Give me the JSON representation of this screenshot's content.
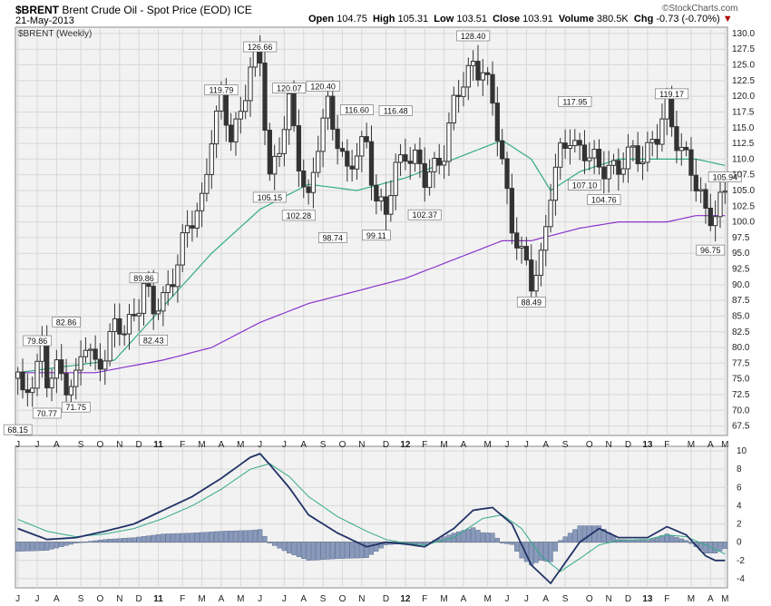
{
  "header": {
    "symbol": "$BRENT",
    "name": "Brent Crude Oil - Spot Price (EOD)",
    "exchange": "ICE",
    "date": "21-May-2013",
    "open_label": "Open",
    "open": "104.75",
    "high_label": "High",
    "high": "105.31",
    "low_label": "Low",
    "low": "103.51",
    "close_label": "Close",
    "close": "103.91",
    "volume_label": "Volume",
    "volume": "380.5K",
    "chg_label": "Chg",
    "chg": "-0.73 (-0.70%)",
    "brand": "©StockCharts.com"
  },
  "colors": {
    "candle": "#333333",
    "ma_short": "#33aa88",
    "ma_long": "#8833cc",
    "macd": "#223366",
    "signal": "#33aa88",
    "histogram": "#8899bb",
    "panel_bg": "#f2f2f2",
    "grid": "#d8d8d8"
  },
  "chart_data": [
    {
      "type": "candlestick",
      "legend": "$BRENT (Weekly)",
      "ylim": [
        66,
        131
      ],
      "y_ticks": [
        67.5,
        70,
        72.5,
        75,
        77.5,
        80,
        82.5,
        85,
        87.5,
        90,
        92.5,
        95,
        97.5,
        100,
        102.5,
        105,
        107.5,
        110,
        112.5,
        115,
        117.5,
        120,
        122.5,
        125,
        127.5,
        130
      ],
      "y_tick_labels": [
        "67.5",
        "70.0",
        "72.5",
        "75.0",
        "77.5",
        "80.0",
        "82.5",
        "85.0",
        "87.5",
        "90.0",
        "92.5",
        "95.0",
        "97.5",
        "100.0",
        "102.5",
        "105.0",
        "107.5",
        "110.0",
        "112.5",
        "115.0",
        "117.5",
        "120.0",
        "122.5",
        "125.0",
        "127.5",
        "130.0"
      ],
      "x_labels": [
        "J",
        "J",
        "A",
        "S",
        "O",
        "N",
        "D",
        "11",
        "F",
        "M",
        "A",
        "M",
        "J",
        "J",
        "A",
        "S",
        "O",
        "N",
        "D",
        "12",
        "F",
        "M",
        "A",
        "M",
        "J",
        "J",
        "A",
        "S",
        "O",
        "N",
        "D",
        "13",
        "F",
        "M",
        "A",
        "M"
      ],
      "close_anchors": [
        [
          0,
          75
        ],
        [
          1,
          71
        ],
        [
          3,
          76
        ],
        [
          5,
          80
        ],
        [
          6,
          74
        ],
        [
          8,
          76
        ],
        [
          10,
          75
        ],
        [
          12,
          75
        ],
        [
          13,
          78
        ],
        [
          14,
          80
        ],
        [
          16,
          77
        ],
        [
          18,
          80
        ],
        [
          20,
          83
        ],
        [
          22,
          82
        ],
        [
          24,
          86
        ],
        [
          26,
          90
        ],
        [
          28,
          85
        ],
        [
          30,
          88
        ],
        [
          32,
          92
        ],
        [
          34,
          96
        ],
        [
          36,
          100
        ],
        [
          38,
          104
        ],
        [
          40,
          114
        ],
        [
          42,
          118
        ],
        [
          44,
          114
        ],
        [
          46,
          118
        ],
        [
          48,
          124
        ],
        [
          50,
          125
        ],
        [
          52,
          108
        ],
        [
          54,
          112
        ],
        [
          56,
          118
        ],
        [
          58,
          110
        ],
        [
          60,
          104
        ],
        [
          62,
          112
        ],
        [
          64,
          118
        ],
        [
          66,
          114
        ],
        [
          68,
          108
        ],
        [
          70,
          110
        ],
        [
          72,
          113
        ],
        [
          74,
          104
        ],
        [
          76,
          101
        ],
        [
          78,
          108
        ],
        [
          80,
          112
        ],
        [
          82,
          110
        ],
        [
          84,
          106
        ],
        [
          86,
          109
        ],
        [
          88,
          112
        ],
        [
          90,
          118
        ],
        [
          92,
          122
        ],
        [
          94,
          126
        ],
        [
          96,
          124
        ],
        [
          98,
          118
        ],
        [
          100,
          110
        ],
        [
          102,
          100
        ],
        [
          104,
          94
        ],
        [
          106,
          90
        ],
        [
          108,
          95
        ],
        [
          110,
          105
        ],
        [
          112,
          110
        ],
        [
          114,
          114
        ],
        [
          116,
          112
        ],
        [
          118,
          110
        ],
        [
          120,
          108
        ],
        [
          122,
          110
        ],
        [
          124,
          108
        ],
        [
          126,
          110
        ],
        [
          128,
          111
        ],
        [
          130,
          112
        ],
        [
          132,
          113
        ],
        [
          134,
          118
        ],
        [
          136,
          114
        ],
        [
          138,
          110
        ],
        [
          140,
          105
        ],
        [
          142,
          102
        ],
        [
          144,
          102
        ],
        [
          145,
          103
        ],
        [
          146,
          104
        ]
      ],
      "labels": [
        {
          "bar": 0,
          "value": 68.15,
          "pos": "below"
        },
        {
          "bar": 4,
          "value": 79.86,
          "pos": "above"
        },
        {
          "bar": 6,
          "value": 70.77,
          "pos": "below"
        },
        {
          "bar": 10,
          "value": 82.86,
          "pos": "above"
        },
        {
          "bar": 12,
          "value": 71.75,
          "pos": "below"
        },
        {
          "bar": 26,
          "value": 89.86,
          "pos": "above"
        },
        {
          "bar": 28,
          "value": 82.43,
          "pos": "below"
        },
        {
          "bar": 42,
          "value": 119.79,
          "pos": "above"
        },
        {
          "bar": 50,
          "value": 126.66,
          "pos": "above"
        },
        {
          "bar": 52,
          "value": 105.15,
          "pos": "below"
        },
        {
          "bar": 58,
          "value": 102.28,
          "pos": "below"
        },
        {
          "bar": 56,
          "value": 120.07,
          "pos": "above"
        },
        {
          "bar": 63,
          "value": 120.4,
          "pos": "above"
        },
        {
          "bar": 65,
          "value": 98.74,
          "pos": "below"
        },
        {
          "bar": 70,
          "value": 116.6,
          "pos": "above"
        },
        {
          "bar": 74,
          "value": 99.11,
          "pos": "below"
        },
        {
          "bar": 78,
          "value": 116.48,
          "pos": "above"
        },
        {
          "bar": 84,
          "value": 102.37,
          "pos": "below"
        },
        {
          "bar": 94,
          "value": 128.4,
          "pos": "above"
        },
        {
          "bar": 106,
          "value": 88.49,
          "pos": "below"
        },
        {
          "bar": 115,
          "value": 117.95,
          "pos": "above"
        },
        {
          "bar": 117,
          "value": 107.1,
          "pos": "below"
        },
        {
          "bar": 121,
          "value": 104.76,
          "pos": "below"
        },
        {
          "bar": 135,
          "value": 119.17,
          "pos": "above"
        },
        {
          "bar": 143,
          "value": 96.75,
          "pos": "below"
        },
        {
          "bar": 146,
          "value": 105.94,
          "pos": "above"
        }
      ],
      "ma_short_anchors": [
        [
          0,
          76
        ],
        [
          20,
          78
        ],
        [
          40,
          95
        ],
        [
          50,
          102
        ],
        [
          60,
          106
        ],
        [
          70,
          105
        ],
        [
          80,
          107
        ],
        [
          90,
          110
        ],
        [
          100,
          113
        ],
        [
          106,
          110
        ],
        [
          110,
          105
        ],
        [
          116,
          108
        ],
        [
          124,
          110
        ],
        [
          134,
          110
        ],
        [
          140,
          110
        ],
        [
          146,
          109
        ]
      ],
      "ma_long_anchors": [
        [
          0,
          76
        ],
        [
          16,
          76
        ],
        [
          30,
          78
        ],
        [
          40,
          80
        ],
        [
          50,
          84
        ],
        [
          60,
          87
        ],
        [
          70,
          89
        ],
        [
          80,
          91
        ],
        [
          90,
          94
        ],
        [
          100,
          97
        ],
        [
          106,
          97
        ],
        [
          116,
          99
        ],
        [
          124,
          100
        ],
        [
          134,
          100
        ],
        [
          140,
          101
        ],
        [
          146,
          101
        ]
      ]
    },
    {
      "type": "macd",
      "ylim": [
        -5,
        10.5
      ],
      "y_ticks": [
        -4,
        -2,
        0,
        2,
        4,
        6,
        8,
        10
      ],
      "y_tick_labels": [
        "-4",
        "-2",
        "0",
        "2",
        "4",
        "6",
        "8",
        "10"
      ],
      "macd_anchors": [
        [
          0,
          1.5
        ],
        [
          6,
          0.3
        ],
        [
          12,
          0.5
        ],
        [
          18,
          1.2
        ],
        [
          24,
          2
        ],
        [
          30,
          3.5
        ],
        [
          36,
          5
        ],
        [
          42,
          7
        ],
        [
          48,
          9.3
        ],
        [
          50,
          9.7
        ],
        [
          52,
          8.5
        ],
        [
          56,
          6
        ],
        [
          60,
          3
        ],
        [
          66,
          1
        ],
        [
          72,
          -0.5
        ],
        [
          76,
          0
        ],
        [
          80,
          -0.2
        ],
        [
          84,
          -0.5
        ],
        [
          90,
          1.5
        ],
        [
          94,
          3.5
        ],
        [
          98,
          3.8
        ],
        [
          102,
          2
        ],
        [
          106,
          -2.5
        ],
        [
          110,
          -4.5
        ],
        [
          112,
          -3
        ],
        [
          116,
          0
        ],
        [
          120,
          1.5
        ],
        [
          124,
          0.5
        ],
        [
          130,
          0.5
        ],
        [
          134,
          1.7
        ],
        [
          138,
          0.8
        ],
        [
          142,
          -1.5
        ],
        [
          144,
          -2
        ],
        [
          146,
          -2
        ]
      ],
      "signal_anchors": [
        [
          0,
          2.5
        ],
        [
          6,
          1.2
        ],
        [
          12,
          0.6
        ],
        [
          18,
          0.9
        ],
        [
          24,
          1.5
        ],
        [
          30,
          2.6
        ],
        [
          36,
          4
        ],
        [
          42,
          5.8
        ],
        [
          48,
          8
        ],
        [
          52,
          8.6
        ],
        [
          56,
          7.2
        ],
        [
          60,
          5
        ],
        [
          66,
          2.8
        ],
        [
          72,
          1.2
        ],
        [
          76,
          0.3
        ],
        [
          80,
          -0.1
        ],
        [
          84,
          -0.3
        ],
        [
          90,
          0.5
        ],
        [
          96,
          2.6
        ],
        [
          100,
          3
        ],
        [
          104,
          1.5
        ],
        [
          108,
          -1.5
        ],
        [
          112,
          -3.2
        ],
        [
          116,
          -1.8
        ],
        [
          120,
          -0.3
        ],
        [
          124,
          0.2
        ],
        [
          130,
          0.3
        ],
        [
          134,
          0.8
        ],
        [
          138,
          0.6
        ],
        [
          142,
          -0.3
        ],
        [
          146,
          -1.3
        ]
      ]
    }
  ]
}
